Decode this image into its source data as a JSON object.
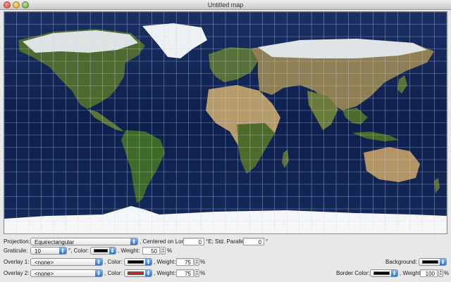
{
  "window": {
    "title": "Untitled map"
  },
  "colors": {
    "ocean": "#0d1d47",
    "land": "#4d6b2e",
    "desert": "#b59c6c",
    "ice": "#f2f4f6",
    "graticule": "#cfd8ea",
    "overlay2": "#d0271e",
    "black": "#000000"
  },
  "projection": {
    "label": "Projection:",
    "value": "Equirectangular",
    "center_label": ", Centered on Lon",
    "center_value": "0",
    "parallel_label": "°E; Std. Parallel:",
    "parallel_value": "0",
    "parallel_unit": "°"
  },
  "graticule": {
    "label": "Graticule:",
    "value": "10",
    "color_label": "°, Color:",
    "weight_label": ", Weight:",
    "weight_value": "50",
    "weight_unit": "%"
  },
  "overlay1": {
    "label": "Overlay 1:",
    "value": "<none>",
    "color_label": ", Color:",
    "weight_label": ", Weight:",
    "weight_value": "75",
    "weight_unit": "%"
  },
  "overlay2": {
    "label": "Overlay 2:",
    "value": "<none>",
    "color_label": ", Color:",
    "weight_label": ", Weight:",
    "weight_value": "75",
    "weight_unit": "%"
  },
  "background": {
    "label": "Background:"
  },
  "border": {
    "label": "Border Color:",
    "weight_label": ", Weight:",
    "weight_value": "100",
    "weight_unit": "%"
  }
}
